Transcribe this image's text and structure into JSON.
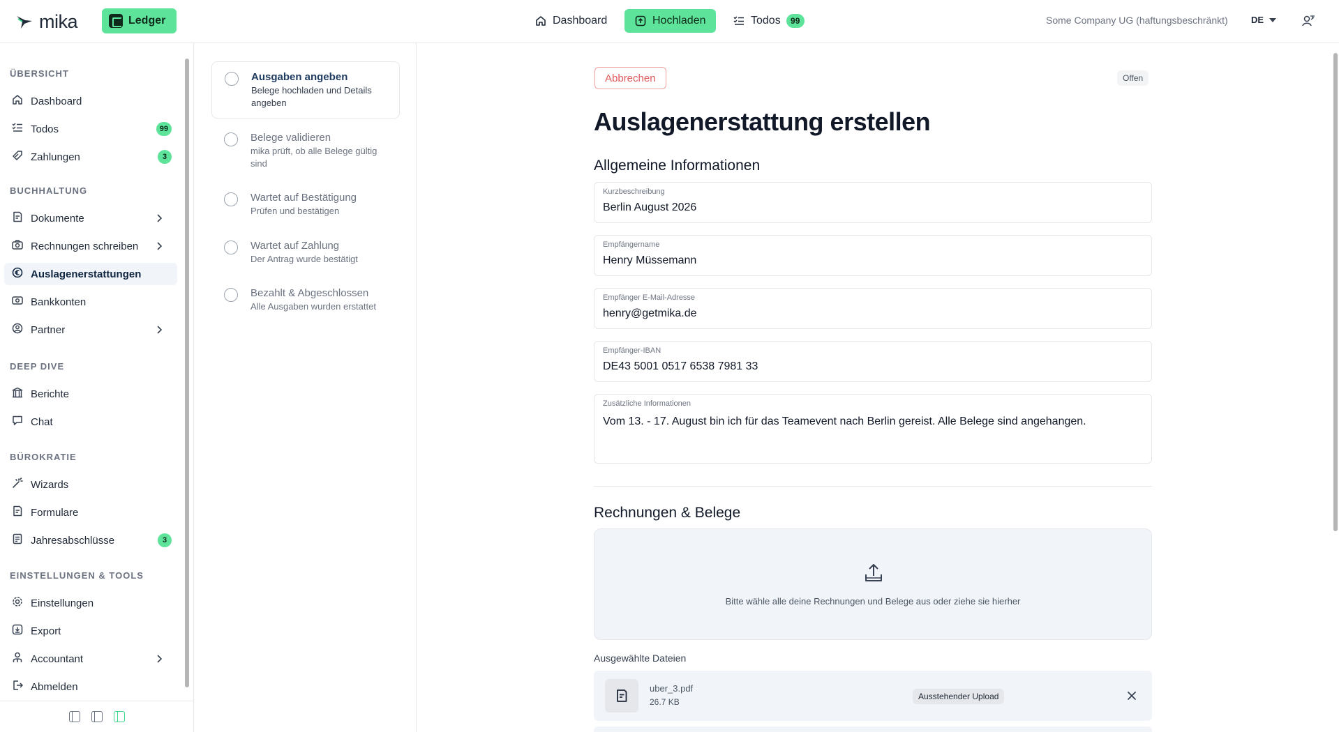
{
  "app": {
    "logo_text": "mika",
    "ledger_label": "Ledger"
  },
  "topnav": {
    "items": [
      {
        "label": "Dashboard",
        "icon": "home-icon"
      },
      {
        "label": "Hochladen",
        "icon": "upload-icon",
        "active": true
      },
      {
        "label": "Todos",
        "icon": "checklist-icon",
        "badge": "99"
      }
    ],
    "company": "Some Company UG (haftungsbeschränkt)",
    "language": "DE"
  },
  "sidebar": {
    "sections": [
      {
        "title": "ÜBERSICHT"
      },
      {
        "title": "BUCHHALTUNG"
      },
      {
        "title": "DEEP DIVE"
      },
      {
        "title": "BÜROKRATIE"
      },
      {
        "title": "EINSTELLUNGEN & TOOLS"
      }
    ],
    "items": [
      {
        "label": "Dashboard",
        "icon": "home-icon"
      },
      {
        "label": "Todos",
        "icon": "checklist-icon",
        "badge": "99"
      },
      {
        "label": "Zahlungen",
        "icon": "tag-icon",
        "badge": "3"
      },
      {
        "label": "Dokumente",
        "icon": "document-icon"
      },
      {
        "label": "Rechnungen schreiben",
        "icon": "camera-icon"
      },
      {
        "label": "Auslagenerstattungen",
        "icon": "euro-icon",
        "active": true
      },
      {
        "label": "Bankkonten",
        "icon": "money-icon"
      },
      {
        "label": "Partner",
        "icon": "partner-icon"
      },
      {
        "label": "Berichte",
        "icon": "building-icon"
      },
      {
        "label": "Chat",
        "icon": "chat-icon"
      },
      {
        "label": "Wizards",
        "icon": "wand-icon"
      },
      {
        "label": "Formulare",
        "icon": "form-icon"
      },
      {
        "label": "Jahresabschlüsse",
        "icon": "report-icon",
        "badge": "3"
      },
      {
        "label": "Einstellungen",
        "icon": "gear-icon"
      },
      {
        "label": "Export",
        "icon": "download-icon"
      },
      {
        "label": "Accountant",
        "icon": "user-icon"
      },
      {
        "label": "Abmelden",
        "icon": "logout-icon"
      }
    ]
  },
  "steps": [
    {
      "title": "Ausgaben angeben",
      "desc": "Belege hochladen und Details angeben",
      "current": true
    },
    {
      "title": "Belege validieren",
      "desc": "mika prüft, ob alle Belege gültig sind"
    },
    {
      "title": "Wartet auf Bestätigung",
      "desc": "Prüfen und bestätigen"
    },
    {
      "title": "Wartet auf Zahlung",
      "desc": "Der Antrag wurde bestätigt"
    },
    {
      "title": "Bezahlt & Abgeschlossen",
      "desc": "Alle Ausgaben wurden erstattet"
    }
  ],
  "main": {
    "cancel_label": "Abbrechen",
    "status": "Offen",
    "title": "Auslagenerstattung erstellen",
    "general_section": "Allgemeine Informationen",
    "fields": [
      {
        "label": "Kurzbeschreibung",
        "value": "Berlin August 2026"
      },
      {
        "label": "Empfängername",
        "value": "Henry Müssemann"
      },
      {
        "label": "Empfänger E-Mail-Adresse",
        "value": "henry@getmika.de"
      },
      {
        "label": "Empfänger-IBAN",
        "value": "DE43 5001 0517 6538 7981 33"
      },
      {
        "label": "Zusätzliche Informationen",
        "value": "Vom 13. - 17. August bin ich für das Teamevent nach Berlin gereist. Alle Belege sind angehangen."
      }
    ],
    "receipts_section": "Rechnungen & Belege",
    "dropzone_text": "Bitte wähle alle deine Rechnungen und Belege aus oder ziehe sie hierher",
    "selected_files_label": "Ausgewählte Dateien",
    "files": [
      {
        "name": "uber_3.pdf",
        "size": "26.7 KB",
        "status": "Ausstehender Upload"
      }
    ]
  },
  "colors": {
    "accent": "#5ee39a",
    "cancel": "#e05a5a",
    "active_nav_bg": "#f1f5f9"
  }
}
